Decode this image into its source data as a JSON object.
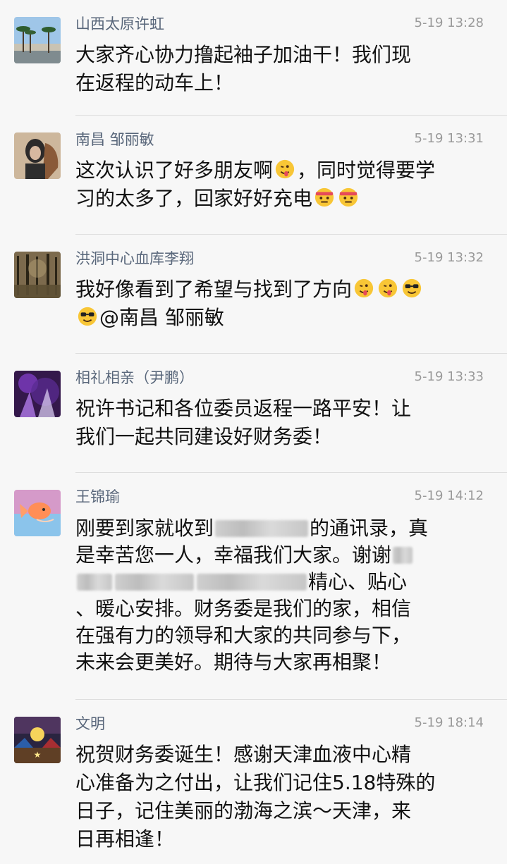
{
  "comments": [
    {
      "name": "山西太原许虹",
      "time": "5-19 13:28",
      "avatar": "palm-tree-avatar",
      "lines": [
        "大家齐心协力撸起袖子加油干！我们现",
        "在返程的动车上！"
      ]
    },
    {
      "name": "南昌 邹丽敏",
      "time": "5-19 13:31",
      "avatar": "woman-horse-avatar",
      "lines": [
        "这次认识了好多朋友啊",
        "，同时觉得要学",
        "习的太多了，回家好好充电"
      ]
    },
    {
      "name": "洪洞中心血库李翔",
      "time": "5-19 13:32",
      "avatar": "forest-avatar",
      "lines": [
        "我好像看到了希望与找到了方向",
        "@南昌 邹丽敏"
      ]
    },
    {
      "name": "相礼相亲（尹鹏）",
      "time": "5-19 13:33",
      "avatar": "purple-fantasy-avatar",
      "lines": [
        "祝许书记和各位委员返程一路平安！让",
        "我们一起共同建设好财务委！"
      ]
    },
    {
      "name": "王锦瑜",
      "time": "5-19 14:12",
      "avatar": "goldfish-avatar",
      "lines": [
        "刚要到家就收到",
        "的通讯录，真",
        "是幸苦您一人，幸福我们大家。谢谢",
        "精心、贴心",
        "、暖心安排。财务委是我们的家，相信",
        "在强有力的领导和大家的共同参与下，",
        "未来会更美好。期待与大家再相聚！"
      ]
    },
    {
      "name": "文明",
      "time": "5-19 18:14",
      "avatar": "game-poster-avatar",
      "lines": [
        "祝贺财务委诞生！感谢天津血液中心精",
        "心准备为之付出，让我们记住5.18特殊的",
        "日子，记住美丽的渤海之滨～天津，来",
        "日再相逢！"
      ]
    }
  ],
  "colors": {
    "background": "#f7f7f7",
    "name": "#58667a",
    "time": "#9a9a9a",
    "text": "#111111",
    "divider": "#dedede"
  }
}
